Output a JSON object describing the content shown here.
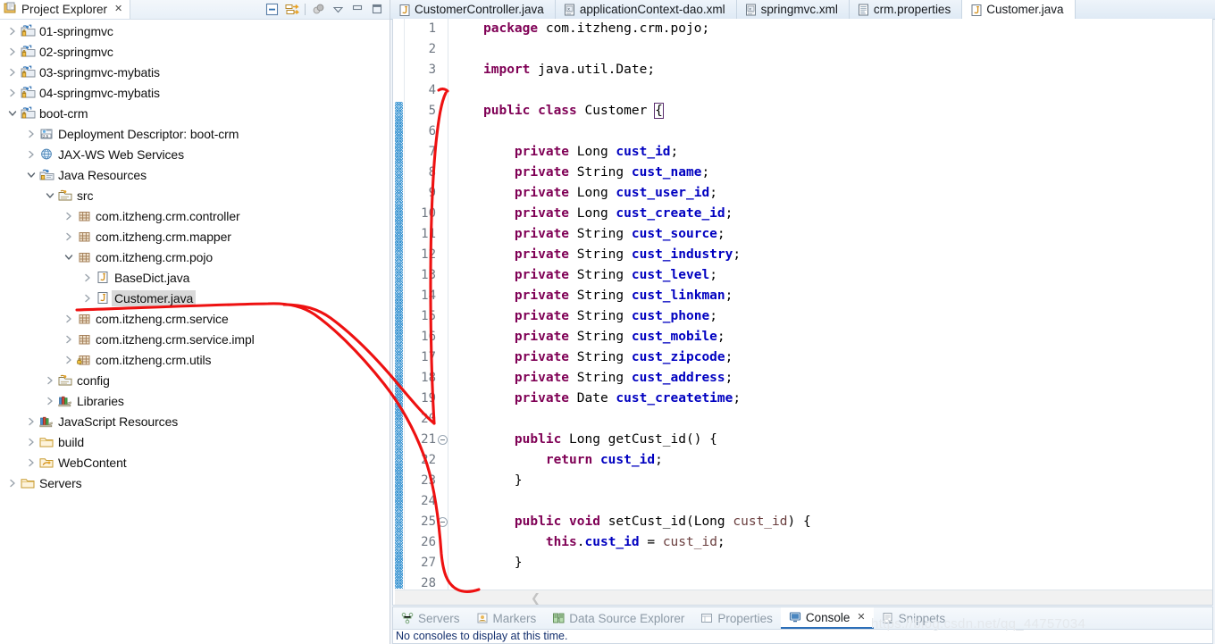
{
  "explorer": {
    "title": "Project Explorer",
    "close_label": "✕",
    "tools": [
      {
        "name": "collapse-all-icon",
        "label": "Collapse All"
      },
      {
        "name": "link-with-editor-icon",
        "label": "Link with Editor"
      },
      {
        "name": "focus-on-active-task-icon",
        "label": "Focus on Active Task"
      },
      {
        "name": "view-menu-icon",
        "label": "View Menu"
      },
      {
        "name": "minimize-icon",
        "label": "Minimize"
      },
      {
        "name": "maximize-icon",
        "label": "Maximize"
      }
    ],
    "tree": [
      {
        "label": "01-springmvc",
        "indent": 0,
        "twist": "collapsed",
        "icon": "java-web-project-icon",
        "selected": false
      },
      {
        "label": "02-springmvc",
        "indent": 0,
        "twist": "collapsed",
        "icon": "java-web-project-icon",
        "selected": false
      },
      {
        "label": "03-springmvc-mybatis",
        "indent": 0,
        "twist": "collapsed",
        "icon": "java-web-project-icon",
        "selected": false
      },
      {
        "label": "04-springmvc-mybatis",
        "indent": 0,
        "twist": "collapsed",
        "icon": "java-web-project-icon",
        "selected": false
      },
      {
        "label": "boot-crm",
        "indent": 0,
        "twist": "expanded",
        "icon": "java-web-project-icon",
        "selected": false
      },
      {
        "label": "Deployment Descriptor: boot-crm",
        "indent": 1,
        "twist": "collapsed",
        "icon": "deployment-descriptor-icon",
        "selected": false
      },
      {
        "label": "JAX-WS Web Services",
        "indent": 1,
        "twist": "collapsed",
        "icon": "web-services-icon",
        "selected": false
      },
      {
        "label": "Java Resources",
        "indent": 1,
        "twist": "expanded",
        "icon": "java-resources-icon",
        "selected": false
      },
      {
        "label": "src",
        "indent": 2,
        "twist": "expanded",
        "icon": "source-folder-icon",
        "selected": false
      },
      {
        "label": "com.itzheng.crm.controller",
        "indent": 3,
        "twist": "collapsed",
        "icon": "package-icon",
        "selected": false
      },
      {
        "label": "com.itzheng.crm.mapper",
        "indent": 3,
        "twist": "collapsed",
        "icon": "package-icon",
        "selected": false
      },
      {
        "label": "com.itzheng.crm.pojo",
        "indent": 3,
        "twist": "expanded",
        "icon": "package-icon",
        "selected": false
      },
      {
        "label": "BaseDict.java",
        "indent": 4,
        "twist": "collapsed",
        "icon": "java-file-icon",
        "selected": false
      },
      {
        "label": "Customer.java",
        "indent": 4,
        "twist": "collapsed",
        "icon": "java-file-icon",
        "selected": true
      },
      {
        "label": "com.itzheng.crm.service",
        "indent": 3,
        "twist": "collapsed",
        "icon": "package-icon",
        "selected": false
      },
      {
        "label": "com.itzheng.crm.service.impl",
        "indent": 3,
        "twist": "collapsed",
        "icon": "package-icon",
        "selected": false
      },
      {
        "label": "com.itzheng.crm.utils",
        "indent": 3,
        "twist": "collapsed",
        "icon": "package-locked-icon",
        "selected": false
      },
      {
        "label": "config",
        "indent": 2,
        "twist": "collapsed",
        "icon": "source-folder-icon",
        "selected": false
      },
      {
        "label": "Libraries",
        "indent": 2,
        "twist": "collapsed",
        "icon": "libraries-icon",
        "selected": false
      },
      {
        "label": "JavaScript Resources",
        "indent": 1,
        "twist": "collapsed",
        "icon": "libraries-icon",
        "selected": false
      },
      {
        "label": "build",
        "indent": 1,
        "twist": "collapsed",
        "icon": "folder-icon",
        "selected": false
      },
      {
        "label": "WebContent",
        "indent": 1,
        "twist": "collapsed",
        "icon": "web-folder-icon",
        "selected": false
      },
      {
        "label": "Servers",
        "indent": 0,
        "twist": "collapsed",
        "icon": "folder-icon",
        "selected": false
      }
    ]
  },
  "editor": {
    "tabs": [
      {
        "label": "CustomerController.java",
        "icon": "java-file-icon",
        "active": false,
        "closeable": false
      },
      {
        "label": "applicationContext-dao.xml",
        "icon": "xml-file-icon",
        "active": false,
        "closeable": false
      },
      {
        "label": "springmvc.xml",
        "icon": "xml-file-icon",
        "active": false,
        "closeable": false
      },
      {
        "label": "crm.properties",
        "icon": "properties-file-icon",
        "active": false,
        "closeable": false
      },
      {
        "label": "Customer.java",
        "icon": "java-file-icon",
        "active": true,
        "closeable": false
      }
    ],
    "lines": [
      {
        "n": "1",
        "fold": false,
        "tokens": [
          {
            "t": "package ",
            "c": "kw"
          },
          {
            "t": "com.itzheng.crm.pojo;",
            "c": "pln"
          }
        ]
      },
      {
        "n": "2",
        "fold": false,
        "tokens": []
      },
      {
        "n": "3",
        "fold": false,
        "tokens": [
          {
            "t": "import ",
            "c": "kw"
          },
          {
            "t": "java.util.Date;",
            "c": "pln"
          }
        ]
      },
      {
        "n": "4",
        "fold": false,
        "tokens": []
      },
      {
        "n": "5",
        "fold": false,
        "tokens": [
          {
            "t": "public ",
            "c": "kw"
          },
          {
            "t": "class ",
            "c": "kw"
          },
          {
            "t": "Customer ",
            "c": "pln"
          },
          {
            "t": "{",
            "c": "brace"
          }
        ]
      },
      {
        "n": "6",
        "fold": false,
        "tokens": []
      },
      {
        "n": "7",
        "fold": false,
        "tokens": [
          {
            "t": "    ",
            "c": "pln"
          },
          {
            "t": "private ",
            "c": "kw"
          },
          {
            "t": "Long ",
            "c": "pln"
          },
          {
            "t": "cust_id",
            "c": "fld"
          },
          {
            "t": ";",
            "c": "pln"
          }
        ]
      },
      {
        "n": "8",
        "fold": false,
        "tokens": [
          {
            "t": "    ",
            "c": "pln"
          },
          {
            "t": "private ",
            "c": "kw"
          },
          {
            "t": "String ",
            "c": "pln"
          },
          {
            "t": "cust_name",
            "c": "fld"
          },
          {
            "t": ";",
            "c": "pln"
          }
        ]
      },
      {
        "n": "9",
        "fold": false,
        "tokens": [
          {
            "t": "    ",
            "c": "pln"
          },
          {
            "t": "private ",
            "c": "kw"
          },
          {
            "t": "Long ",
            "c": "pln"
          },
          {
            "t": "cust_user_id",
            "c": "fld"
          },
          {
            "t": ";",
            "c": "pln"
          }
        ]
      },
      {
        "n": "10",
        "fold": false,
        "tokens": [
          {
            "t": "    ",
            "c": "pln"
          },
          {
            "t": "private ",
            "c": "kw"
          },
          {
            "t": "Long ",
            "c": "pln"
          },
          {
            "t": "cust_create_id",
            "c": "fld"
          },
          {
            "t": ";",
            "c": "pln"
          }
        ]
      },
      {
        "n": "11",
        "fold": false,
        "tokens": [
          {
            "t": "    ",
            "c": "pln"
          },
          {
            "t": "private ",
            "c": "kw"
          },
          {
            "t": "String ",
            "c": "pln"
          },
          {
            "t": "cust_source",
            "c": "fld"
          },
          {
            "t": ";",
            "c": "pln"
          }
        ]
      },
      {
        "n": "12",
        "fold": false,
        "tokens": [
          {
            "t": "    ",
            "c": "pln"
          },
          {
            "t": "private ",
            "c": "kw"
          },
          {
            "t": "String ",
            "c": "pln"
          },
          {
            "t": "cust_industry",
            "c": "fld"
          },
          {
            "t": ";",
            "c": "pln"
          }
        ]
      },
      {
        "n": "13",
        "fold": false,
        "tokens": [
          {
            "t": "    ",
            "c": "pln"
          },
          {
            "t": "private ",
            "c": "kw"
          },
          {
            "t": "String ",
            "c": "pln"
          },
          {
            "t": "cust_level",
            "c": "fld"
          },
          {
            "t": ";",
            "c": "pln"
          }
        ]
      },
      {
        "n": "14",
        "fold": false,
        "tokens": [
          {
            "t": "    ",
            "c": "pln"
          },
          {
            "t": "private ",
            "c": "kw"
          },
          {
            "t": "String ",
            "c": "pln"
          },
          {
            "t": "cust_linkman",
            "c": "fld"
          },
          {
            "t": ";",
            "c": "pln"
          }
        ]
      },
      {
        "n": "15",
        "fold": false,
        "tokens": [
          {
            "t": "    ",
            "c": "pln"
          },
          {
            "t": "private ",
            "c": "kw"
          },
          {
            "t": "String ",
            "c": "pln"
          },
          {
            "t": "cust_phone",
            "c": "fld"
          },
          {
            "t": ";",
            "c": "pln"
          }
        ]
      },
      {
        "n": "16",
        "fold": false,
        "tokens": [
          {
            "t": "    ",
            "c": "pln"
          },
          {
            "t": "private ",
            "c": "kw"
          },
          {
            "t": "String ",
            "c": "pln"
          },
          {
            "t": "cust_mobile",
            "c": "fld"
          },
          {
            "t": ";",
            "c": "pln"
          }
        ]
      },
      {
        "n": "17",
        "fold": false,
        "tokens": [
          {
            "t": "    ",
            "c": "pln"
          },
          {
            "t": "private ",
            "c": "kw"
          },
          {
            "t": "String ",
            "c": "pln"
          },
          {
            "t": "cust_zipcode",
            "c": "fld"
          },
          {
            "t": ";",
            "c": "pln"
          }
        ]
      },
      {
        "n": "18",
        "fold": false,
        "tokens": [
          {
            "t": "    ",
            "c": "pln"
          },
          {
            "t": "private ",
            "c": "kw"
          },
          {
            "t": "String ",
            "c": "pln"
          },
          {
            "t": "cust_address",
            "c": "fld"
          },
          {
            "t": ";",
            "c": "pln"
          }
        ]
      },
      {
        "n": "19",
        "fold": false,
        "tokens": [
          {
            "t": "    ",
            "c": "pln"
          },
          {
            "t": "private ",
            "c": "kw"
          },
          {
            "t": "Date ",
            "c": "pln"
          },
          {
            "t": "cust_createtime",
            "c": "fld"
          },
          {
            "t": ";",
            "c": "pln"
          }
        ]
      },
      {
        "n": "20",
        "fold": false,
        "tokens": []
      },
      {
        "n": "21",
        "fold": true,
        "tokens": [
          {
            "t": "    ",
            "c": "pln"
          },
          {
            "t": "public ",
            "c": "kw"
          },
          {
            "t": "Long getCust_id() {",
            "c": "pln"
          }
        ]
      },
      {
        "n": "22",
        "fold": false,
        "tokens": [
          {
            "t": "        ",
            "c": "pln"
          },
          {
            "t": "return ",
            "c": "kw"
          },
          {
            "t": "cust_id",
            "c": "fld"
          },
          {
            "t": ";",
            "c": "pln"
          }
        ]
      },
      {
        "n": "23",
        "fold": false,
        "tokens": [
          {
            "t": "    }",
            "c": "pln"
          }
        ]
      },
      {
        "n": "24",
        "fold": false,
        "tokens": []
      },
      {
        "n": "25",
        "fold": true,
        "tokens": [
          {
            "t": "    ",
            "c": "pln"
          },
          {
            "t": "public ",
            "c": "kw"
          },
          {
            "t": "void ",
            "c": "kw"
          },
          {
            "t": "setCust_id(Long ",
            "c": "pln"
          },
          {
            "t": "cust_id",
            "c": "prm"
          },
          {
            "t": ") {",
            "c": "pln"
          }
        ]
      },
      {
        "n": "26",
        "fold": false,
        "tokens": [
          {
            "t": "        ",
            "c": "pln"
          },
          {
            "t": "this",
            "c": "kw"
          },
          {
            "t": ".",
            "c": "pln"
          },
          {
            "t": "cust_id",
            "c": "fld"
          },
          {
            "t": " = ",
            "c": "pln"
          },
          {
            "t": "cust_id",
            "c": "prm"
          },
          {
            "t": ";",
            "c": "pln"
          }
        ]
      },
      {
        "n": "27",
        "fold": false,
        "tokens": [
          {
            "t": "    }",
            "c": "pln"
          }
        ]
      },
      {
        "n": "28",
        "fold": false,
        "tokens": []
      }
    ]
  },
  "bottom": {
    "tabs": [
      {
        "label": "Servers",
        "icon": "servers-icon",
        "active": false,
        "closeable": false
      },
      {
        "label": "Markers",
        "icon": "markers-icon",
        "active": false,
        "closeable": false
      },
      {
        "label": "Data Source Explorer",
        "icon": "data-source-icon",
        "active": false,
        "closeable": false
      },
      {
        "label": "Properties",
        "icon": "properties-icon",
        "active": false,
        "closeable": false
      },
      {
        "label": "Console",
        "icon": "console-icon",
        "active": true,
        "closeable": true
      },
      {
        "label": "Snippets",
        "icon": "snippets-icon",
        "active": false,
        "closeable": false
      }
    ],
    "close_label": "✕",
    "console_text": "No consoles to display at this time."
  },
  "watermark": "https://blog.csdn.net/qq_44757034",
  "colors": {
    "keyword": "#7f0055",
    "field": "#0000c0",
    "parameter": "#6a3e3e",
    "plain": "#000000",
    "line_number": "#6f7782",
    "annotation_red": "#ee1111",
    "change_bar": "#2f8fd0",
    "selection": "#d9d9d9",
    "tab_active_bg": "#ffffff",
    "accent": "#2d6fb8"
  }
}
